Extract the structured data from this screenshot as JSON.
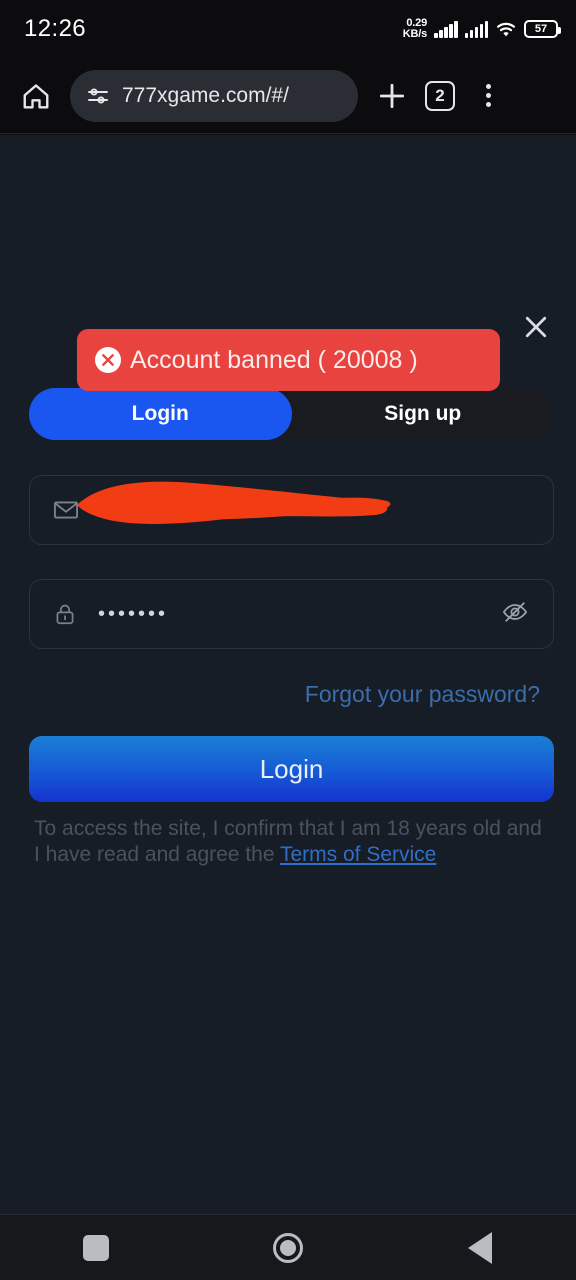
{
  "statusbar": {
    "time": "12:26",
    "net_speed_value": "0.29",
    "net_speed_unit": "KB/s",
    "battery_percent": "57",
    "icons": [
      "signal-bars-icon",
      "signal-bars-icon",
      "wifi-icon",
      "battery-icon"
    ]
  },
  "toolbar": {
    "home_icon": "home-icon",
    "site_info_icon": "site-settings-icon",
    "url": "777xgame.com/#/",
    "new_tab_icon": "plus-icon",
    "tab_count": "2",
    "menu_icon": "more-vertical-icon"
  },
  "page": {
    "close_label": "×",
    "toast": {
      "icon": "error-circle-icon",
      "message": "Account banned ( 20008 )",
      "bg_color": "#e8433f",
      "text_color": "#fdeaea"
    },
    "tabs": [
      {
        "label": "Login",
        "active": true
      },
      {
        "label": "Sign up",
        "active": false
      }
    ],
    "accent_color": "#1a56f0",
    "email_field": {
      "icon": "envelope-icon",
      "value": "",
      "redacted": true,
      "redaction_color": "#f23c14"
    },
    "password_field": {
      "icon": "lock-icon",
      "value": "•••••••",
      "toggle_icon": "eye-off-icon"
    },
    "forgot_password": "Forgot your password?",
    "login_button": "Login",
    "disclaimer": {
      "text_before": "To access the site, I confirm that I am 18 years old and I have read and agree the ",
      "link": "Terms of Service"
    }
  },
  "navbar": {
    "recents_icon": "square-icon",
    "home_icon": "circle-icon",
    "back_icon": "triangle-left-icon"
  }
}
